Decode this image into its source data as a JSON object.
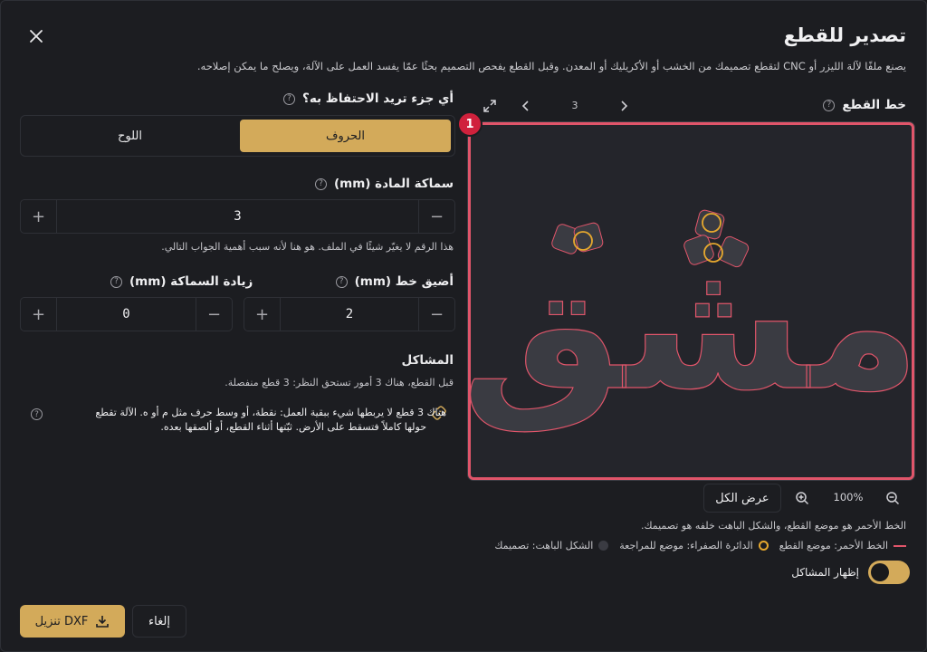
{
  "dialog": {
    "title": "تصدير للقطع",
    "subtitle": "يصنع ملفًا لآلة الليزر أو CNC لتقطع تصميمك من الخشب أو الأكريليك أو المعدن. وقبل القطع يفحص التصميم بحثًا عمّا يفسد العمل على الآلة، ويصلح ما يمكن إصلاحه."
  },
  "preview": {
    "label": "خط القطع",
    "page_number": "3",
    "badge": "1",
    "zoom_label": "100%",
    "fit_label": "عرض الكل",
    "word": "مشق",
    "legend_note": "الخط الأحمر هو موضع القطع، والشكل الباهت خلفه هو تصميمك.",
    "legend": {
      "red": "الخط الأحمر: موضع القطع",
      "yellow": "الدائرة الصفراء: موضع للمراجعة",
      "gray": "الشكل الباهت: تصميمك"
    },
    "show_issues_label": "إظهار المشاكل",
    "show_issues": true
  },
  "keep": {
    "question": "أي جزء تريد الاحتفاظ به؟",
    "options": [
      "الحروف",
      "اللوح"
    ],
    "selected": "الحروف"
  },
  "thickness": {
    "label": "سماكة المادة (mm)",
    "value": "3",
    "hint": "هذا الرقم لا يغيّر شيئًا في الملف. هو هنا لأنه سبب أهمية الجواب التالي."
  },
  "min_line": {
    "label": "أضيق خط (mm)",
    "value": "2"
  },
  "extra_thickness": {
    "label": "زيادة السماكة (mm)",
    "value": "0"
  },
  "issues": {
    "title": "المشاكل",
    "summary": "قبل القطع، هناك 3 أمور تستحق النظر: 3 قطع منفصلة.",
    "item_line1": "هناك 3 قطع لا يربطها شيء ببقية العمل: نقطة، أو وسط حرف مثل م أو ه. الآلة تقطع",
    "item_line2": "حولها كاملاً فتسقط على الأرض. ثبّتها أثناء القطع، أو ألصقها بعده."
  },
  "footer": {
    "download_label": "تنزيل DXF",
    "cancel_label": "إلغاء"
  },
  "colors": {
    "accent": "#d3aa5a",
    "cut_line": "#e0556a",
    "badge": "#d0213c",
    "review_circle": "#e6a82e"
  },
  "icons": [
    "close-icon",
    "help-icon",
    "expand-icon",
    "chevron-left-icon",
    "chevron-right-icon",
    "zoom-in-icon",
    "zoom-out-icon",
    "broken-link-icon",
    "download-icon",
    "plus-icon",
    "minus-icon"
  ]
}
